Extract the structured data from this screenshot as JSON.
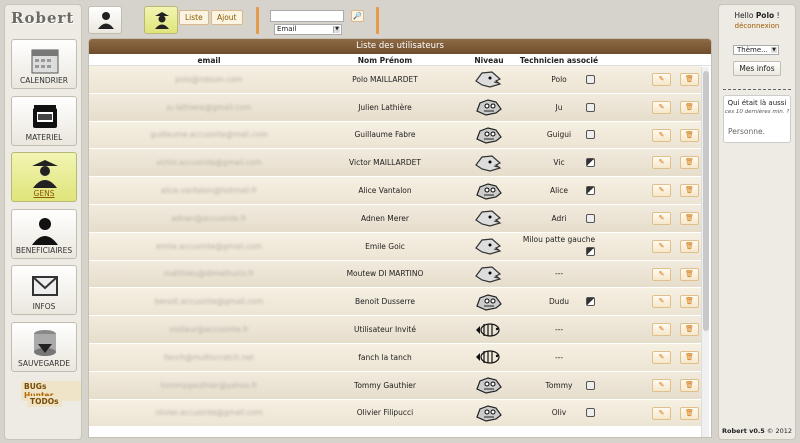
{
  "app": {
    "logo": "Robert"
  },
  "nav": {
    "items": [
      {
        "id": "calendrier",
        "label": "CALENDRIER",
        "icon": "calendar-icon"
      },
      {
        "id": "materiel",
        "label": "MATERIEL",
        "icon": "flight-case-icon"
      },
      {
        "id": "gens",
        "label": "GENS",
        "icon": "people-icon",
        "active": true
      },
      {
        "id": "beneficiaires",
        "label": "BENEFICIAIRES",
        "icon": "person-icon"
      },
      {
        "id": "infos",
        "label": "INFOS",
        "icon": "envelope-icon"
      },
      {
        "id": "sauvegarde",
        "label": "SAUVEGARDE",
        "icon": "database-icon"
      }
    ],
    "bugs_prefix": "BUGs",
    "bugs_suffix": "Hunter",
    "todos": "TODOs"
  },
  "toolbar": {
    "liste": "Liste",
    "ajout": "Ajout",
    "search_btn": "🔎",
    "search_placeholder": "",
    "search_field": "Email"
  },
  "main": {
    "title": "Liste des utilisateurs",
    "headers": {
      "email": "email",
      "name": "Nom Prénom",
      "niveau": "Niveau",
      "tech": "Technicien associé"
    },
    "rows": [
      {
        "email": "polo@robson.com",
        "name": "Polo MAILLARDET",
        "niveau": "admin",
        "tech": "Polo",
        "tech_icon": "normal"
      },
      {
        "email": "ju.lathiere@gmail.com",
        "name": "Julien Lathière",
        "niveau": "dev",
        "tech": "Ju",
        "tech_icon": "normal"
      },
      {
        "email": "guillaume.accusinte@mail.com",
        "name": "Guillaume Fabre",
        "niveau": "dev",
        "tech": "Guigui",
        "tech_icon": "normal"
      },
      {
        "email": "victor.accusinte@gmail.com",
        "name": "Victor MAILLARDET",
        "niveau": "admin",
        "tech": "Vic",
        "tech_icon": "alt"
      },
      {
        "email": "alice.vantalon@hotmail.fr",
        "name": "Alice Vantalon",
        "niveau": "dev",
        "tech": "Alice",
        "tech_icon": "alt"
      },
      {
        "email": "adnan@accusinte.fr",
        "name": "Adnen Merer",
        "niveau": "admin",
        "tech": "Adri",
        "tech_icon": "normal"
      },
      {
        "email": "emile.accusinte@gmail.com",
        "name": "Emile Goic",
        "niveau": "admin",
        "tech": "Milou patte gauche",
        "tech_icon": "alt"
      },
      {
        "email": "matthieu@dimathurio.fr",
        "name": "Moutew DI MARTINO",
        "niveau": "admin",
        "tech": "---",
        "tech_icon": "none"
      },
      {
        "email": "benoit.accusinte@gmail.com",
        "name": "Benoit Dusserre",
        "niveau": "dev",
        "tech": "Dudu",
        "tech_icon": "alt"
      },
      {
        "email": "visiteur@accusinte.fr",
        "name": "Utilisateur Invité",
        "niveau": "fish",
        "tech": "---",
        "tech_icon": "none"
      },
      {
        "email": "fanch@multiscratch.net",
        "name": "fanch la tanch",
        "niveau": "fish",
        "tech": "---",
        "tech_icon": "none"
      },
      {
        "email": "tommygauthier@yahoo.fr",
        "name": "Tommy Gauthier",
        "niveau": "dev",
        "tech": "Tommy",
        "tech_icon": "normal"
      },
      {
        "email": "olivier.accusinte@gmail.com",
        "name": "Olivier Filipucci",
        "niveau": "dev",
        "tech": "Oliv",
        "tech_icon": "normal"
      }
    ],
    "edit_glyph": "✎",
    "delete_glyph": "🗑"
  },
  "right": {
    "hello_prefix": "Hello",
    "user": "Polo",
    "hello_suffix": "!",
    "logout": "déconnexion",
    "theme": "Thème...",
    "mes_infos": "Mes infos",
    "who_title": "Qui était là aussi",
    "who_sub": "ces 10 dernières min. ?",
    "who_list": "Personne.",
    "version_name": "Robert v0.5",
    "version_rest": "© 2012"
  },
  "colors": {
    "accent": "#e49b4a",
    "header": "#7e5a38",
    "active_nav": "#e2e67f"
  }
}
